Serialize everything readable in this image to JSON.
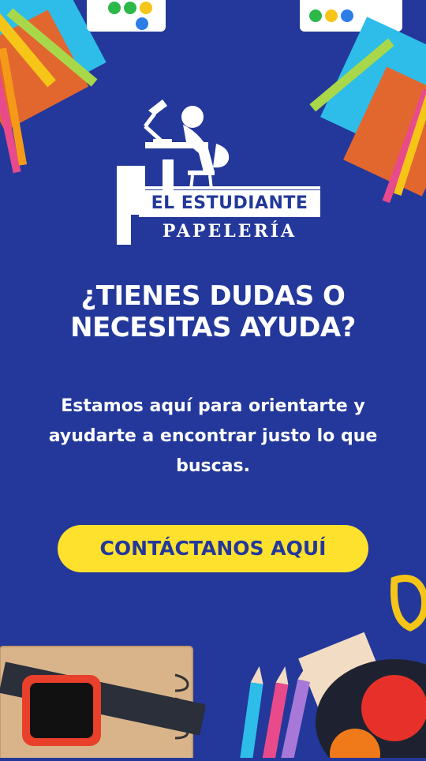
{
  "brand": {
    "name_line1": "EL ESTUDIANTE",
    "name_line2": "PAPELERÍA"
  },
  "headline": "¿TIENES DUDAS O NECESITAS AYUDA?",
  "subtext": "Estamos aquí para orientarte y ayudarte a encontrar justo lo que buscas.",
  "cta": {
    "label": "CONTÁCTANOS AQUÍ"
  },
  "colors": {
    "background": "#23389a",
    "accent_yellow": "#fde12d",
    "text": "#ffffff"
  },
  "icons": [
    "student-desk-logo-icon",
    "school-supplies-decoration"
  ]
}
